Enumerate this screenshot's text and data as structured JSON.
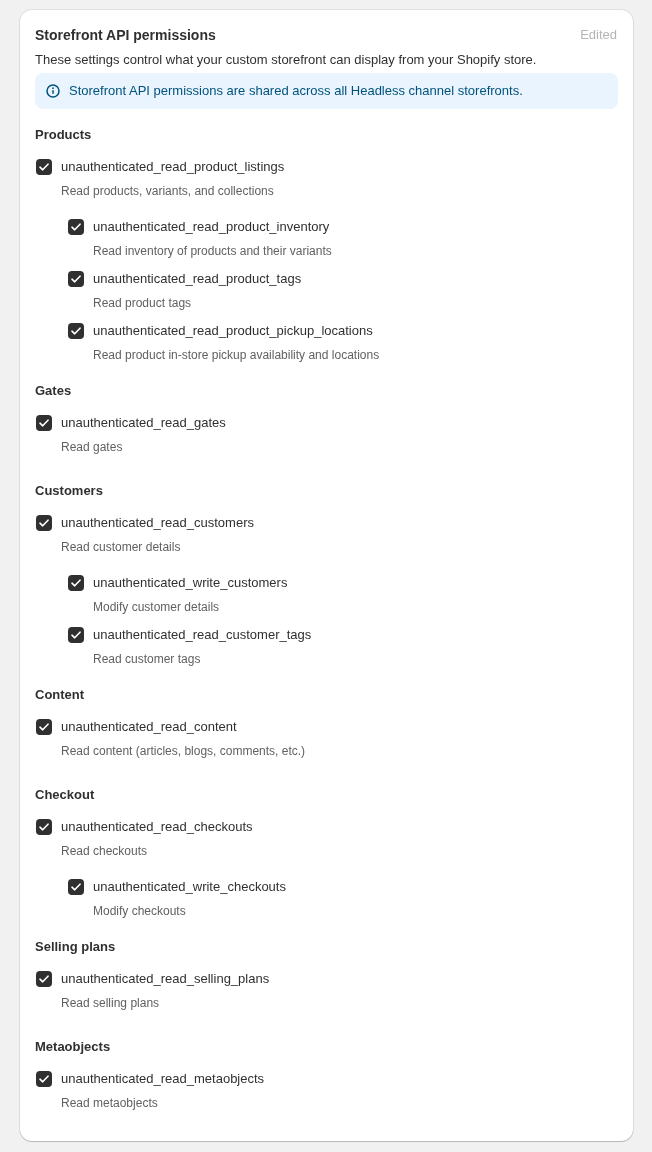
{
  "card": {
    "title": "Storefront API permissions",
    "status": "Edited",
    "description": "These settings control what your custom storefront can display from your Shopify store.",
    "banner": {
      "text": "Storefront API permissions are shared across all Headless channel storefronts."
    }
  },
  "sections": [
    {
      "heading": "Products",
      "items": [
        {
          "scope": "unauthenticated_read_product_listings",
          "description": "Read products, variants, and collections",
          "checked": true,
          "children": [
            {
              "scope": "unauthenticated_read_product_inventory",
              "description": "Read inventory of products and their variants",
              "checked": true
            },
            {
              "scope": "unauthenticated_read_product_tags",
              "description": "Read product tags",
              "checked": true
            },
            {
              "scope": "unauthenticated_read_product_pickup_locations",
              "description": "Read product in-store pickup availability and locations",
              "checked": true
            }
          ]
        }
      ]
    },
    {
      "heading": "Gates",
      "items": [
        {
          "scope": "unauthenticated_read_gates",
          "description": "Read gates",
          "checked": true
        }
      ]
    },
    {
      "heading": "Customers",
      "items": [
        {
          "scope": "unauthenticated_read_customers",
          "description": "Read customer details",
          "checked": true,
          "children": [
            {
              "scope": "unauthenticated_write_customers",
              "description": "Modify customer details",
              "checked": true
            },
            {
              "scope": "unauthenticated_read_customer_tags",
              "description": "Read customer tags",
              "checked": true
            }
          ]
        }
      ]
    },
    {
      "heading": "Content",
      "items": [
        {
          "scope": "unauthenticated_read_content",
          "description": "Read content (articles, blogs, comments, etc.)",
          "checked": true
        }
      ]
    },
    {
      "heading": "Checkout",
      "items": [
        {
          "scope": "unauthenticated_read_checkouts",
          "description": "Read checkouts",
          "checked": true,
          "children": [
            {
              "scope": "unauthenticated_write_checkouts",
              "description": "Modify checkouts",
              "checked": true
            }
          ]
        }
      ]
    },
    {
      "heading": "Selling plans",
      "items": [
        {
          "scope": "unauthenticated_read_selling_plans",
          "description": "Read selling plans",
          "checked": true
        }
      ]
    },
    {
      "heading": "Metaobjects",
      "items": [
        {
          "scope": "unauthenticated_read_metaobjects",
          "description": "Read metaobjects",
          "checked": true
        }
      ]
    }
  ]
}
